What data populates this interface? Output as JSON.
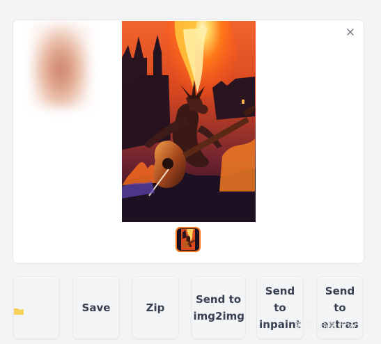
{
  "gallery": {
    "close_icon": "close-icon",
    "thumbnail_selected": true
  },
  "buttons": {
    "folder": {
      "icon": "folder-icon",
      "label": ""
    },
    "save": "Save",
    "zip": "Zip",
    "send_img2img": "Send to img2img",
    "send_inpaint": "Send to inpaint",
    "send_extras": "Send to extras"
  },
  "watermark": "知乎 @量步云",
  "colors": {
    "accent": "#f97316",
    "background": "#f3f4f6",
    "button_text": "#374151",
    "folder": "#f5c542"
  }
}
